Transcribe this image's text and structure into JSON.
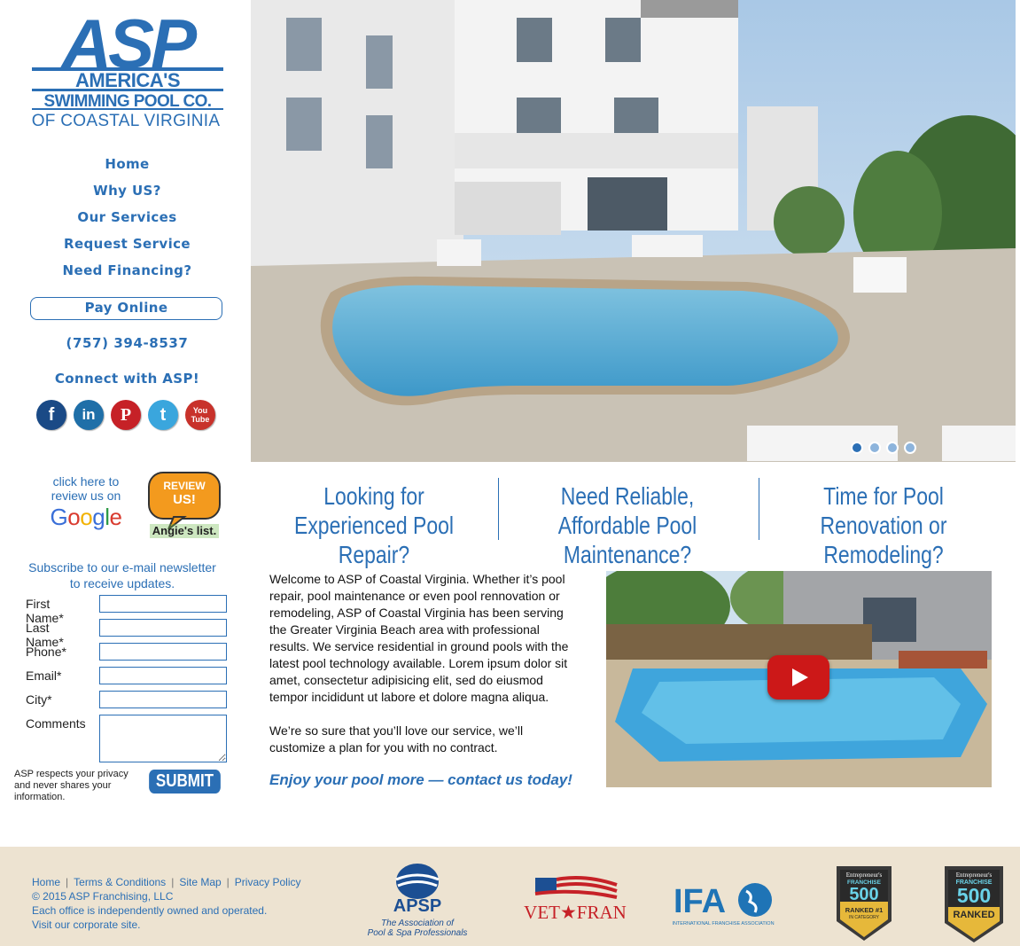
{
  "brand": {
    "logo_main": "ASP",
    "logo_line1": "AMERICA'S",
    "logo_line2": "SWIMMING POOL CO.",
    "logo_line3": "OF COASTAL VIRGINIA",
    "color": "#2b6fb5"
  },
  "nav": {
    "items": [
      {
        "label": "Home"
      },
      {
        "label": "Why US?"
      },
      {
        "label": "Our Services"
      },
      {
        "label": "Request Service"
      },
      {
        "label": "Need Financing?"
      }
    ],
    "pay_online": "Pay Online",
    "phone": "(757) 394-8537",
    "connect": "Connect with ASP!"
  },
  "social": [
    {
      "icon": "facebook-icon",
      "glyph": "f",
      "color": "#1a4a86"
    },
    {
      "icon": "linkedin-icon",
      "glyph": "in",
      "color": "#1f6fa8"
    },
    {
      "icon": "pinterest-icon",
      "glyph": "P",
      "color": "#c62127"
    },
    {
      "icon": "twitter-icon",
      "glyph": "t",
      "color": "#3aa6dd"
    },
    {
      "icon": "youtube-icon",
      "glyph": "You Tube",
      "color": "#c8322b"
    }
  ],
  "reviews": {
    "google_text": "click here to review us on",
    "google_word": "Google",
    "angies_top": "REVIEW US!",
    "angies_bottom": "Angie's list."
  },
  "newsletter": {
    "intro": "Subscribe to our e-mail newsletter to receive updates.",
    "fields": [
      {
        "label": "First Name*"
      },
      {
        "label": "Last Name*"
      },
      {
        "label": "Phone*"
      },
      {
        "label": "Email*"
      },
      {
        "label": "City*"
      }
    ],
    "comments_label": "Comments",
    "privacy": "ASP respects your privacy and never shares your information.",
    "submit": "SUBMIT"
  },
  "hero": {
    "slides": 4,
    "active_slide": 1
  },
  "headlines": [
    "Looking for Experienced Pool Repair?",
    "Need Reliable, Affordable Pool Maintenance?",
    "Time for Pool Renovation or Remodeling?"
  ],
  "welcome": {
    "paragraph1": "Welcome to ASP of Coastal Virginia. Whether it’s pool repair, pool maintenance or even pool rennovation or remodeling, ASP of Coastal Virginia has been serving the Greater Virginia Beach area with professional results. We service residential in ground pools with the latest pool technology available. Lorem ipsum dolor sit amet, consectetur adipisicing elit, sed do eiusmod tempor incididunt ut labore et dolore magna aliqua.",
    "paragraph2": "We’re so sure that you’ll love our service, we’ll customize a plan for you with no contract.",
    "cta": "Enjoy your pool more — contact us today!"
  },
  "footer": {
    "links": [
      "Home",
      "Terms & Conditions",
      "Site Map",
      "Privacy Policy"
    ],
    "copyright": "© 2015 ASP Franchising, LLC",
    "note": "Each office is independently owned and operated.",
    "corporate": "Visit our corporate site."
  },
  "partners": {
    "apsp": "APSP",
    "apsp_sub1": "The Association of",
    "apsp_sub2": "Pool & Spa Professionals",
    "vetfran": "VET★FRAN",
    "ifa": "IFA",
    "ifa_sub": "INTERNATIONAL FRANCHISE ASSOCIATION",
    "ent_top": "Entrepreneur's",
    "ent_mid": "FRANCHISE",
    "ent_num": "500",
    "ent_rank1": "RANKED #1",
    "ent_rank1_sub": "IN CATEGORY",
    "ent_rank2": "RANKED"
  }
}
